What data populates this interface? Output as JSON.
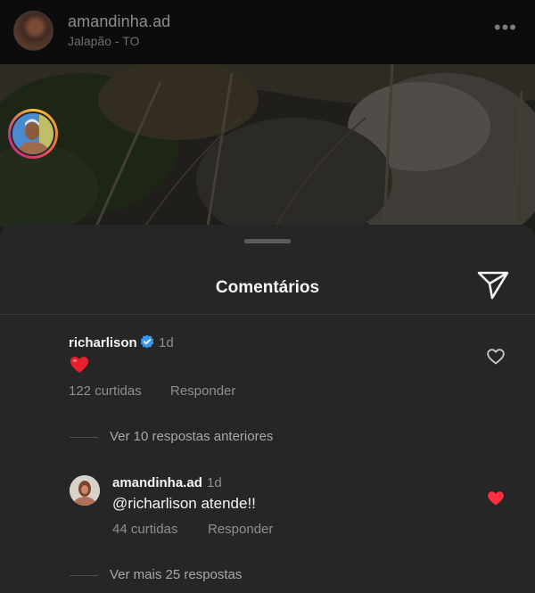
{
  "post": {
    "username": "amandinha.ad",
    "location": "Jalapão - TO",
    "more_icon": "more-horizontal-icon"
  },
  "comments_sheet": {
    "title": "Comentários",
    "share_icon": "send-icon"
  },
  "comment": {
    "username": "richarlison",
    "verified_icon": "verified-badge-icon",
    "time": "1d",
    "text_emoji": "red-heart-emoji",
    "likes": "122 curtidas",
    "reply_label": "Responder",
    "liked": false
  },
  "view_previous_replies": "Ver 10 respostas anteriores",
  "reply": {
    "username": "amandinha.ad",
    "time": "1d",
    "text": "@richarlison atende!!",
    "likes": "44 curtidas",
    "reply_label": "Responder",
    "liked": true
  },
  "view_more_replies": "Ver mais 25 respostas",
  "colors": {
    "sheet_bg": "#262626",
    "text_primary": "#f5f5f5",
    "text_secondary": "#8e8e8e",
    "like_red": "#ff3040",
    "verified_blue": "#3897f0"
  }
}
